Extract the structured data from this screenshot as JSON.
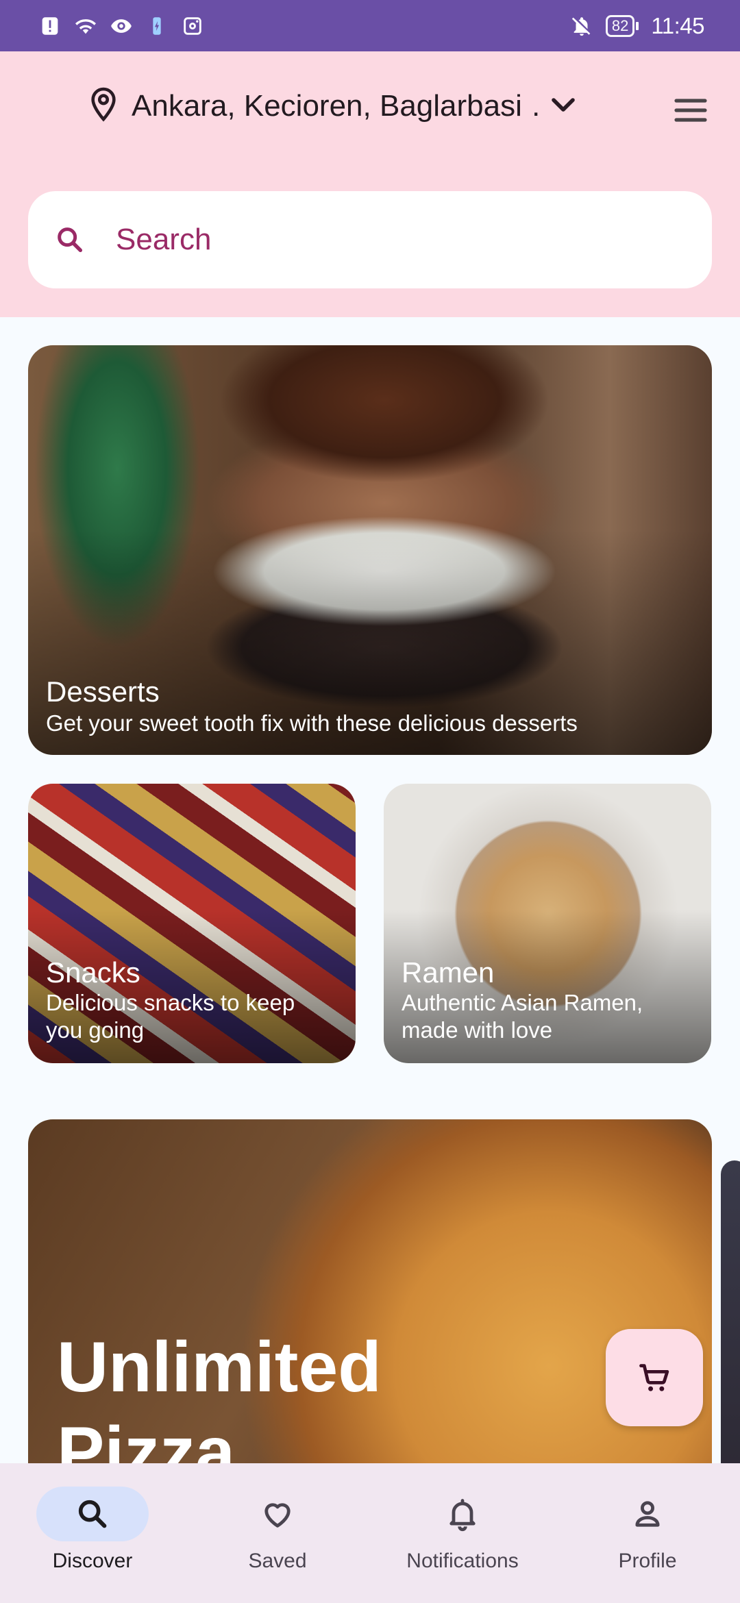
{
  "status_bar": {
    "battery": "82",
    "time": "11:45",
    "icons": [
      "alert-icon",
      "wifi-icon",
      "eye-icon",
      "battery-saver-icon",
      "instagram-icon",
      "bell-off-icon"
    ]
  },
  "header": {
    "location": "Ankara, Kecioren, Baglarbasi …",
    "search_placeholder": "Search"
  },
  "cards": {
    "desserts": {
      "title": "Desserts",
      "subtitle": "Get your sweet tooth fix with these delicious desserts"
    },
    "snacks": {
      "title": "Snacks",
      "subtitle": "Delicious snacks to keep you going"
    },
    "ramen": {
      "title": "Ramen",
      "subtitle": "Authentic Asian Ramen, made with love"
    },
    "promo": {
      "title": "Unlimited Pizza"
    }
  },
  "bottom_nav": {
    "items": [
      {
        "label": "Discover",
        "icon": "search-icon",
        "active": true
      },
      {
        "label": "Saved",
        "icon": "heart-icon",
        "active": false
      },
      {
        "label": "Notifications",
        "icon": "bell-icon",
        "active": false
      },
      {
        "label": "Profile",
        "icon": "person-icon",
        "active": false
      }
    ]
  },
  "colors": {
    "status_bar": "#6a4fa6",
    "header_bg": "#fcd9e2",
    "accent": "#9a2a66",
    "nav_bg": "#f1e7f1",
    "nav_active_pill": "#d7e1fb"
  }
}
